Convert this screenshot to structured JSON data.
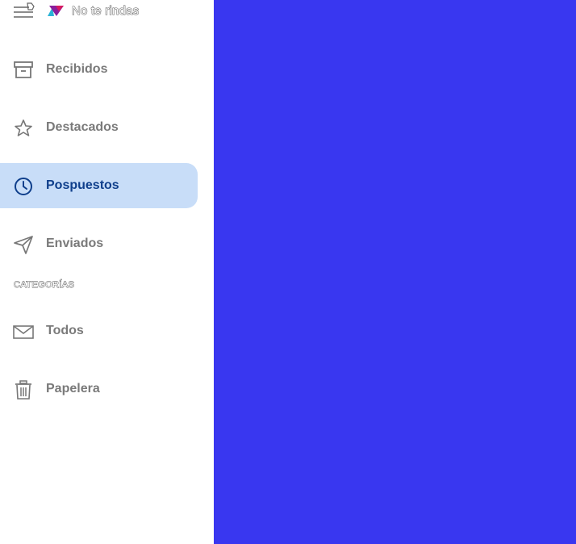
{
  "app": {
    "title": "No te rindas",
    "menu_icon": "menu-icon",
    "logo_icon": "triangle-logo-icon"
  },
  "nav": {
    "items": [
      {
        "label": "Recibidos",
        "icon": "archive-box-icon",
        "active": false
      },
      {
        "label": "Destacados",
        "icon": "star-icon",
        "active": false
      },
      {
        "label": "Pospuestos",
        "icon": "clock-icon",
        "active": true
      },
      {
        "label": "Enviados",
        "icon": "send-icon",
        "active": false
      }
    ]
  },
  "categories": {
    "title": "CATEGORÍAS",
    "items": [
      {
        "label": "Todos",
        "icon": "envelope-icon"
      },
      {
        "label": "Papelera",
        "icon": "trash-icon"
      }
    ]
  },
  "colors": {
    "accent": "#c8ddf8",
    "active_text": "#0f3f8c",
    "main_panel": "#3937f0",
    "text_muted": "#7a7a7a"
  }
}
